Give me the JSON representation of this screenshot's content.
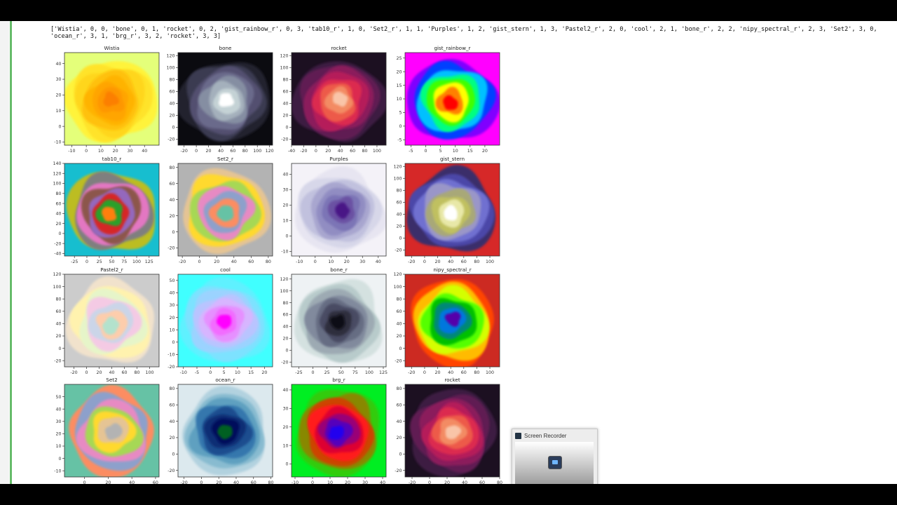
{
  "output_text": "['Wistia', 0, 0, 'bone', 0, 1, 'rocket', 0, 2, 'gist_rainbow_r', 0, 3, 'tab10_r', 1, 0, 'Set2_r', 1, 1, 'Purples', 1, 2, 'gist_stern', 1, 3, 'Pastel2_r', 2, 0, 'cool', 2, 1, 'bone_r', 2, 2, 'nipy_spectral_r', 2, 3, 'Set2', 3, 0, 'ocean_r', 3, 1, 'brg_r', 3, 2, 'rocket', 3, 3]",
  "recorder": {
    "title": "Screen Recorder"
  },
  "chart_data": [
    {
      "type": "heatmap",
      "title": "Wistia",
      "cmap": "Wistia",
      "xlim": [
        -15,
        50
      ],
      "ylim": [
        -12,
        47
      ],
      "xticks": [
        -10,
        0,
        10,
        20,
        30,
        40
      ],
      "yticks": [
        -10,
        0,
        10,
        20,
        30,
        40
      ],
      "colors": [
        "#e4ff7a",
        "#fff33b",
        "#ffe329",
        "#ffd61b",
        "#ffc10e",
        "#ffb300",
        "#ffa500",
        "#fe9700",
        "#fc7f00"
      ]
    },
    {
      "type": "heatmap",
      "title": "bone",
      "cmap": "bone",
      "xlim": [
        -30,
        125
      ],
      "ylim": [
        -30,
        125
      ],
      "xticks": [
        -20,
        0,
        20,
        40,
        60,
        80,
        100,
        120
      ],
      "yticks": [
        -20,
        0,
        20,
        40,
        60,
        80,
        100,
        120
      ],
      "colors": [
        "#0b0b10",
        "#22222f",
        "#3a3a51",
        "#524f70",
        "#6b6b8b",
        "#858ea2",
        "#a4b0bc",
        "#c4d2d5",
        "#ffffff"
      ]
    },
    {
      "type": "heatmap",
      "title": "rocket",
      "cmap": "rocket",
      "xlim": [
        -40,
        115
      ],
      "ylim": [
        -30,
        125
      ],
      "xticks": [
        -40,
        -20,
        0,
        20,
        40,
        60,
        80,
        100
      ],
      "yticks": [
        -20,
        0,
        20,
        40,
        60,
        80,
        100,
        120
      ],
      "colors": [
        "#1c1021",
        "#3c1a42",
        "#611f53",
        "#8b1f5c",
        "#b51e5a",
        "#dc2b4f",
        "#ed5a48",
        "#f38b64",
        "#f9c5a8"
      ]
    },
    {
      "type": "heatmap",
      "title": "gist_rainbow_r",
      "cmap": "gist_rainbow_r",
      "xlim": [
        -7,
        25
      ],
      "ylim": [
        -7,
        27
      ],
      "xticks": [
        -5,
        0,
        5,
        10,
        15,
        20
      ],
      "yticks": [
        -5,
        0,
        5,
        10,
        15,
        20,
        25
      ],
      "colors": [
        "#ff00ff",
        "#8000ff",
        "#0040ff",
        "#00c0ff",
        "#00ff80",
        "#40ff00",
        "#ffff00",
        "#ff8000",
        "#ff0000"
      ]
    },
    {
      "type": "heatmap",
      "title": "tab10_r",
      "cmap": "tab10_r",
      "xlim": [
        -45,
        145
      ],
      "ylim": [
        -45,
        140
      ],
      "xticks": [
        -25,
        0,
        25,
        50,
        75,
        100,
        125
      ],
      "yticks": [
        -40,
        -20,
        0,
        20,
        40,
        60,
        80,
        100,
        120,
        140
      ],
      "colors": [
        "#17becf",
        "#bcbd22",
        "#7f7f7f",
        "#e377c2",
        "#8c564b",
        "#9467bd",
        "#d62728",
        "#2ca02c",
        "#ff7f0e"
      ]
    },
    {
      "type": "heatmap",
      "title": "Set2_r",
      "cmap": "Set2_r",
      "xlim": [
        -25,
        85
      ],
      "ylim": [
        -30,
        85
      ],
      "xticks": [
        -20,
        0,
        20,
        40,
        60,
        80
      ],
      "yticks": [
        -20,
        0,
        20,
        40,
        60,
        80
      ],
      "colors": [
        "#b3b3b3",
        "#e5c494",
        "#ffd92f",
        "#a6d854",
        "#e78ac3",
        "#8da0cb",
        "#fc8d62",
        "#66c2a5"
      ]
    },
    {
      "type": "heatmap",
      "title": "Purples",
      "cmap": "Purples",
      "xlim": [
        -15,
        45
      ],
      "ylim": [
        -13,
        47
      ],
      "xticks": [
        -10,
        0,
        10,
        20,
        30,
        40
      ],
      "yticks": [
        -10,
        0,
        10,
        20,
        30,
        40
      ],
      "colors": [
        "#f4f2f8",
        "#e7e5f1",
        "#d7d7e9",
        "#c1c1de",
        "#a8a6cf",
        "#918dc2",
        "#7c75b6",
        "#6a51a3",
        "#4a1486"
      ]
    },
    {
      "type": "heatmap",
      "title": "gist_stern",
      "cmap": "gist_stern",
      "xlim": [
        -30,
        115
      ],
      "ylim": [
        -30,
        125
      ],
      "xticks": [
        -20,
        0,
        20,
        40,
        60,
        80,
        100
      ],
      "yticks": [
        -20,
        0,
        20,
        40,
        60,
        80,
        100,
        120
      ],
      "colors": [
        "#d62828",
        "#3b2d6b",
        "#4c46a8",
        "#6f6fd0",
        "#9a96c8",
        "#a8a878",
        "#c0c060",
        "#e8e8a8",
        "#ffffff"
      ]
    },
    {
      "type": "heatmap",
      "title": "Pastel2_r",
      "cmap": "Pastel2_r",
      "xlim": [
        -35,
        115
      ],
      "ylim": [
        -30,
        120
      ],
      "xticks": [
        -20,
        0,
        20,
        40,
        60,
        80,
        100
      ],
      "yticks": [
        -20,
        0,
        20,
        40,
        60,
        80,
        100,
        120
      ],
      "colors": [
        "#cccccc",
        "#f1e2cc",
        "#fff2ae",
        "#e6f5c9",
        "#f4cae4",
        "#cbd5e8",
        "#fdcdac",
        "#b3e2cd"
      ]
    },
    {
      "type": "heatmap",
      "title": "cool",
      "cmap": "cool",
      "xlim": [
        -12,
        23
      ],
      "ylim": [
        -20,
        55
      ],
      "xticks": [
        -10,
        -5,
        0,
        5,
        10,
        15,
        20
      ],
      "yticks": [
        -20,
        -10,
        0,
        10,
        20,
        30,
        40,
        50
      ],
      "colors": [
        "#40ffff",
        "#5ef1ff",
        "#7de2ff",
        "#9bd3ff",
        "#b9c4ff",
        "#d7b5ff",
        "#e690ff",
        "#f26cff",
        "#ff00ff"
      ]
    },
    {
      "type": "heatmap",
      "title": "bone_r",
      "cmap": "bone_r",
      "xlim": [
        -38,
        130
      ],
      "ylim": [
        -28,
        128
      ],
      "xticks": [
        -25,
        0,
        25,
        50,
        75,
        100,
        125
      ],
      "yticks": [
        -20,
        0,
        20,
        40,
        60,
        80,
        100,
        120
      ],
      "colors": [
        "#eef2f4",
        "#d4e1e0",
        "#b8cbcb",
        "#9daab3",
        "#818a9d",
        "#666d83",
        "#4a4c63",
        "#2d2d3e",
        "#0d0d14"
      ]
    },
    {
      "type": "heatmap",
      "title": "nipy_spectral_r",
      "cmap": "nipy_spectral_r",
      "xlim": [
        -30,
        115
      ],
      "ylim": [
        -30,
        120
      ],
      "xticks": [
        -20,
        0,
        20,
        40,
        60,
        80,
        100
      ],
      "yticks": [
        -20,
        0,
        20,
        40,
        60,
        80,
        100,
        120
      ],
      "colors": [
        "#cc2a22",
        "#ff4400",
        "#ffbb00",
        "#d4ff00",
        "#55ff00",
        "#00c000",
        "#008877",
        "#0077dd",
        "#5500aa"
      ]
    },
    {
      "type": "heatmap",
      "title": "Set2",
      "cmap": "Set2",
      "xlim": [
        -17,
        63
      ],
      "ylim": [
        -15,
        60
      ],
      "xticks": [
        0,
        20,
        40,
        60
      ],
      "yticks": [
        -10,
        0,
        10,
        20,
        30,
        40,
        50
      ],
      "colors": [
        "#66c2a5",
        "#fc8d62",
        "#8da0cb",
        "#e78ac3",
        "#a6d854",
        "#ffd92f",
        "#e5c494",
        "#b3b3b3"
      ]
    },
    {
      "type": "heatmap",
      "title": "ocean_r",
      "cmap": "ocean_r",
      "xlim": [
        -27,
        82
      ],
      "ylim": [
        -28,
        85
      ],
      "xticks": [
        -20,
        0,
        20,
        40,
        60,
        80
      ],
      "yticks": [
        -20,
        0,
        20,
        40,
        60,
        80
      ],
      "colors": [
        "#dce9ee",
        "#b2d2df",
        "#88bbd0",
        "#5ea0c0",
        "#3677ad",
        "#1d4e8f",
        "#102f75",
        "#06115c",
        "#006020"
      ]
    },
    {
      "type": "heatmap",
      "title": "brg_r",
      "cmap": "brg_r",
      "xlim": [
        -12,
        42
      ],
      "ylim": [
        -7,
        43
      ],
      "xticks": [
        -10,
        0,
        10,
        20,
        30,
        40
      ],
      "yticks": [
        0,
        10,
        20,
        30,
        40
      ],
      "colors": [
        "#00ee22",
        "#33cc11",
        "#888800",
        "#cc4400",
        "#ff1a1a",
        "#dd0033",
        "#990077",
        "#5500bb",
        "#2200ee"
      ]
    },
    {
      "type": "heatmap",
      "title": "rocket",
      "cmap": "rocket",
      "xlim": [
        -28,
        80
      ],
      "ylim": [
        -28,
        85
      ],
      "xticks": [
        -20,
        0,
        20,
        40,
        60,
        80
      ],
      "yticks": [
        -20,
        0,
        20,
        40,
        60,
        80
      ],
      "colors": [
        "#1c1021",
        "#3c1a42",
        "#611f53",
        "#8b1f5c",
        "#b51e5a",
        "#dc2b4f",
        "#ed5a48",
        "#f38b64",
        "#f9c5a8"
      ]
    }
  ]
}
